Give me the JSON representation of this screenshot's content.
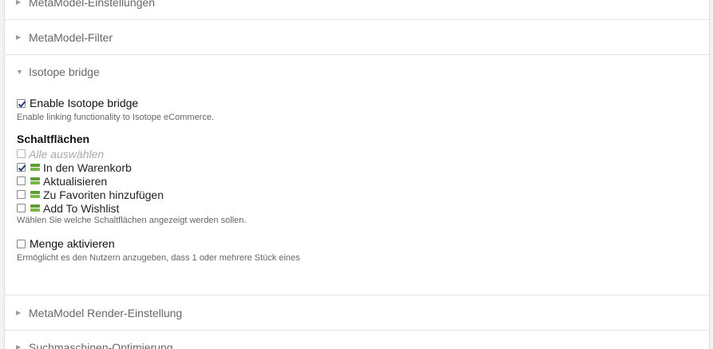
{
  "sections": {
    "settings": {
      "label": "MetaModel-Einstellungen"
    },
    "filter": {
      "label": "MetaModel-Filter"
    },
    "isotope": {
      "label": "Isotope bridge"
    },
    "render": {
      "label": "MetaModel Render-Einstellung"
    },
    "seo": {
      "label": "Suchmaschinen-Optimierung"
    }
  },
  "enable_bridge": {
    "label": "Enable Isotope bridge",
    "checked": true,
    "tip": "Enable linking functionality to Isotope eCommerce."
  },
  "buttons": {
    "heading": "Schaltflächen",
    "select_all": "Alle auswählen",
    "options": [
      {
        "label": "In den Warenkorb",
        "checked": true,
        "icon": "cart-button-icon"
      },
      {
        "label": "Aktualisieren",
        "checked": false,
        "icon": "update-button-icon"
      },
      {
        "label": "Zu Favoriten hinzufügen",
        "checked": false,
        "icon": "favorites-button-icon"
      },
      {
        "label": "Add To Wishlist",
        "checked": false,
        "icon": "wishlist-button-icon"
      }
    ],
    "tip": "Wählen Sie welche Schaltflächen angezeigt werden sollen."
  },
  "quantity": {
    "label": "Menge aktivieren",
    "checked": false,
    "tip": "Ermöglicht es den Nutzern anzugeben, dass 1 oder mehrere Stück eines"
  },
  "colors": {
    "accent_green": "#7ab648",
    "check": "#1e3f7a"
  }
}
